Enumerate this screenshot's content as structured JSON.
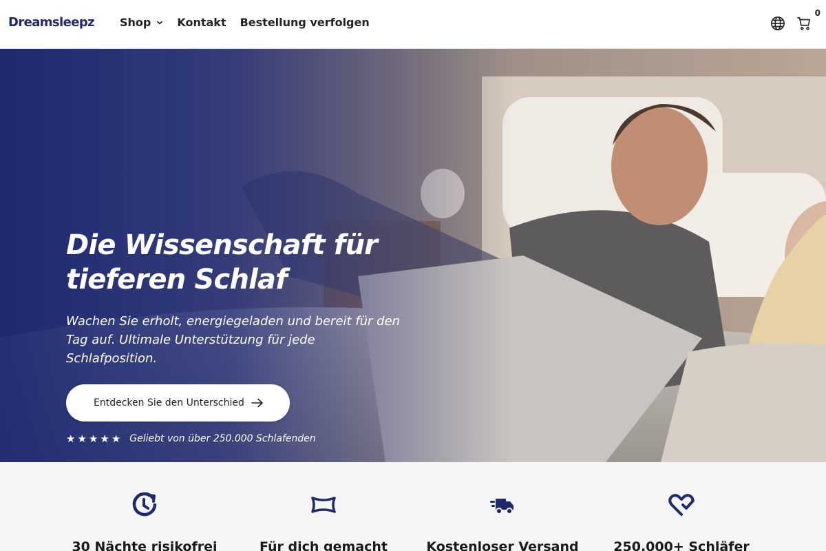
{
  "brand": {
    "name": "Dreamsleepz",
    "color": "#1f2a6b"
  },
  "nav": {
    "items": [
      {
        "label": "Shop",
        "has_dropdown": true
      },
      {
        "label": "Kontakt",
        "has_dropdown": false
      },
      {
        "label": "Bestellung verfolgen",
        "has_dropdown": false
      }
    ]
  },
  "header_icons": {
    "language": "globe-icon",
    "cart": "cart-icon",
    "cart_count": "0"
  },
  "hero": {
    "title_line1": "Die Wissenschaft für",
    "title_line2": "tieferen Schlaf",
    "subtitle": "Wachen Sie erholt, energiegeladen und bereit für den Tag auf. Ultimale Unterstützung für jede Schlafposition.",
    "cta_label": "Entdecken Sie den Unterschied",
    "rating_stars": 5,
    "rating_text": "Geliebt von über 250.000 Schlafenden",
    "overlay_color": "#1e2a76"
  },
  "features": [
    {
      "icon": "clock-refresh-icon",
      "title": "30 Nächte risikofrei"
    },
    {
      "icon": "pillow-icon",
      "title": "Für dich gemacht"
    },
    {
      "icon": "truck-icon",
      "title": "Kostenloser Versand"
    },
    {
      "icon": "heart-check-icon",
      "title": "250.000+ Schläfer"
    }
  ],
  "colors": {
    "accent": "#1f2a6b",
    "feature_bg": "#f5f5f5"
  }
}
